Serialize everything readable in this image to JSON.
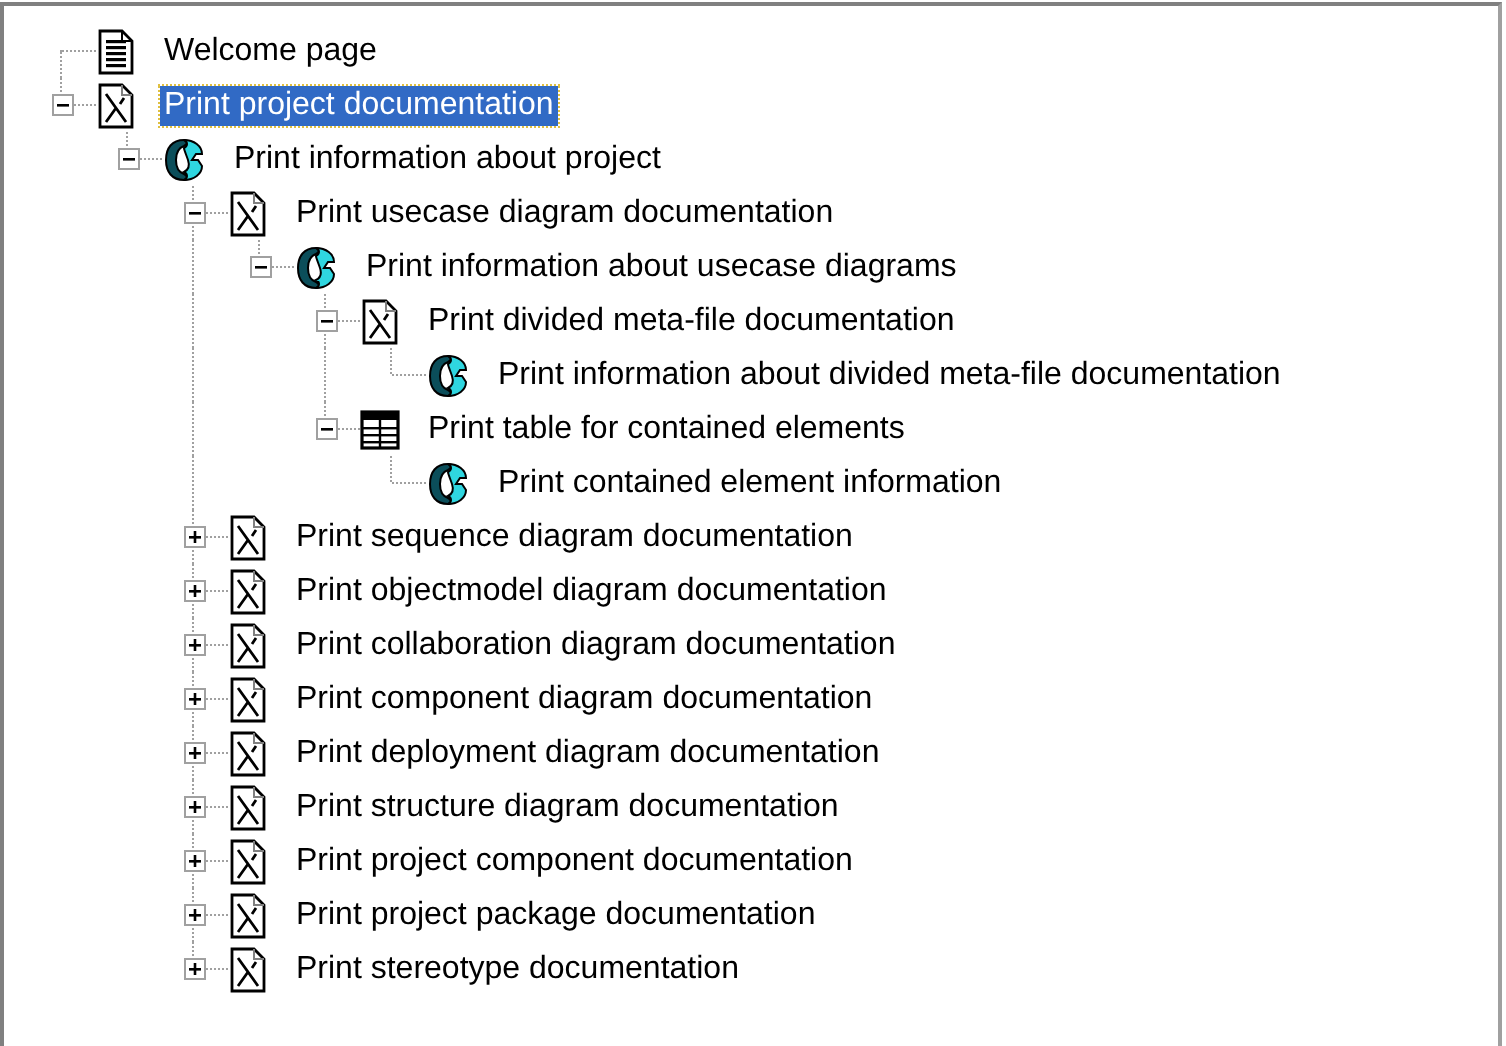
{
  "tree": [
    {
      "label": "Welcome page",
      "kind": "page",
      "selected": false
    },
    {
      "label": "Print project documentation",
      "kind": "diagram",
      "selected": true,
      "expanded": true,
      "children": [
        {
          "label": "Print information about project",
          "kind": "script",
          "selected": false,
          "expanded": true,
          "children": [
            {
              "label": "Print usecase diagram documentation",
              "kind": "diagram",
              "selected": false,
              "expanded": true,
              "children": [
                {
                  "label": "Print information about usecase diagrams",
                  "kind": "script",
                  "selected": false,
                  "expanded": true,
                  "children": [
                    {
                      "label": "Print divided meta-file documentation",
                      "kind": "diagram",
                      "selected": false,
                      "expanded": true,
                      "children": [
                        {
                          "label": "Print information about divided meta-file documentation",
                          "kind": "script",
                          "selected": false
                        }
                      ]
                    },
                    {
                      "label": "Print table for contained elements",
                      "kind": "table",
                      "selected": false,
                      "expanded": true,
                      "children": [
                        {
                          "label": "Print contained element information",
                          "kind": "script",
                          "selected": false
                        }
                      ]
                    }
                  ]
                }
              ]
            },
            {
              "label": "Print sequence diagram documentation",
              "kind": "diagram",
              "selected": false,
              "expanded": false
            },
            {
              "label": "Print objectmodel diagram documentation",
              "kind": "diagram",
              "selected": false,
              "expanded": false
            },
            {
              "label": "Print collaboration diagram documentation",
              "kind": "diagram",
              "selected": false,
              "expanded": false
            },
            {
              "label": "Print component diagram documentation",
              "kind": "diagram",
              "selected": false,
              "expanded": false
            },
            {
              "label": "Print deployment diagram documentation",
              "kind": "diagram",
              "selected": false,
              "expanded": false
            },
            {
              "label": "Print structure diagram documentation",
              "kind": "diagram",
              "selected": false,
              "expanded": false
            },
            {
              "label": "Print project component documentation",
              "kind": "diagram",
              "selected": false,
              "expanded": false
            },
            {
              "label": "Print project package documentation",
              "kind": "diagram",
              "selected": false,
              "expanded": false
            },
            {
              "label": "Print stereotype documentation",
              "kind": "diagram",
              "selected": false,
              "expanded": false
            }
          ]
        }
      ]
    }
  ]
}
